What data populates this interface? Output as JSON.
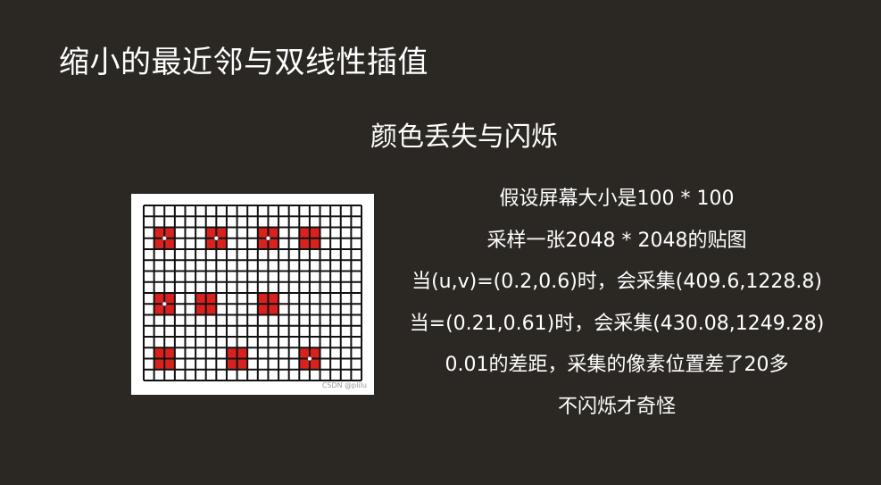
{
  "slide": {
    "title": "缩小的最近邻与双线性插值",
    "subtitle": "颜色丢失与闪烁"
  },
  "figure": {
    "grid_cols": 21,
    "grid_rows": 16,
    "line_color": "#111111",
    "mark_color": "#d9221e",
    "dot_color": "#ffffff",
    "watermark": "CSDN @plilu",
    "marks": [
      {
        "col": 1,
        "row": 2,
        "dot": true
      },
      {
        "col": 6,
        "row": 2,
        "dot": true
      },
      {
        "col": 11,
        "row": 2,
        "dot": true
      },
      {
        "col": 15,
        "row": 2,
        "dot": false
      },
      {
        "col": 1,
        "row": 8,
        "dot": true
      },
      {
        "col": 5,
        "row": 8,
        "dot": false
      },
      {
        "col": 11,
        "row": 8,
        "dot": false
      },
      {
        "col": 1,
        "row": 13,
        "dot": false
      },
      {
        "col": 8,
        "row": 13,
        "dot": false
      },
      {
        "col": 15,
        "row": 13,
        "dot": true
      }
    ]
  },
  "text_lines": [
    "假设屏幕大小是100 * 100",
    "采样一张2048 * 2048的贴图",
    "当(u,v)=(0.2,0.6)时，会采集(409.6,1228.8)",
    "当=(0.21,0.61)时，会采集(430.08,1249.28)",
    "0.01的差距，采集的像素位置差了20多",
    "不闪烁才奇怪"
  ]
}
